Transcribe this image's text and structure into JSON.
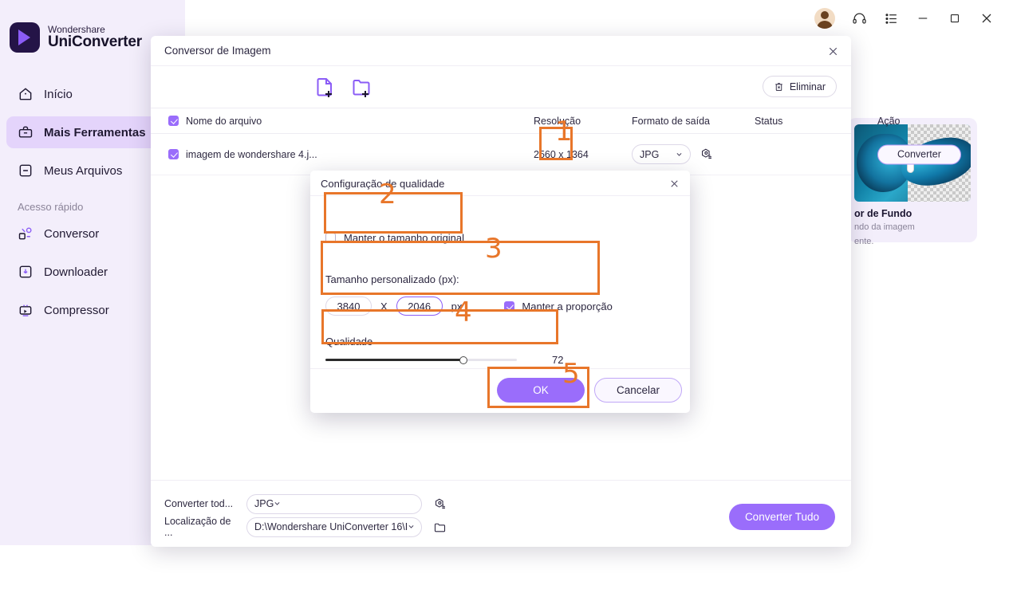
{
  "app": {
    "brand_top": "Wondershare",
    "brand_bottom": "UniConverter",
    "nav": [
      {
        "label": "Início",
        "icon": "home-icon"
      },
      {
        "label": "Mais Ferramentas",
        "icon": "toolbox-icon"
      },
      {
        "label": "Meus Arquivos",
        "icon": "files-icon"
      }
    ],
    "nav_section": "Acesso rápido",
    "quick": [
      {
        "label": "Conversor",
        "icon": "converter-icon"
      },
      {
        "label": "Downloader",
        "icon": "download-icon"
      },
      {
        "label": "Compressor",
        "icon": "compress-icon"
      }
    ],
    "window_controls": {
      "avatar": "avatar",
      "headset": "headset-icon",
      "menu": "list-menu-icon",
      "minimize": "minimize-icon",
      "maximize": "maximize-icon",
      "close": "close-icon"
    }
  },
  "tool_card": {
    "title": "or de Fundo",
    "desc_line1": "ndo da imagem",
    "desc_line2": "ente."
  },
  "modal": {
    "title": "Conversor de Imagem",
    "close_icon": "close-icon",
    "toolbar": {
      "add_file_icon": "add-file-icon",
      "add_folder_icon": "add-folder-icon",
      "delete_label": "Eliminar",
      "delete_icon": "trash-icon"
    },
    "table": {
      "headers": [
        "Nome do arquivo",
        "Resolução",
        "Formato de saída",
        "Status",
        "Ação"
      ],
      "rows": [
        {
          "checked": true,
          "name": "imagem de wondershare 4.j...",
          "resolution": "2560 x 1364",
          "format": "JPG",
          "gear_icon": "settings-image-icon",
          "status_icon": "clock-icon",
          "action": "Converter"
        }
      ]
    },
    "footer": {
      "convert_all_label": "Converter tod...",
      "convert_all_value": "JPG",
      "convert_all_gear": "settings-image-icon",
      "location_label": "Localização de ...",
      "location_value": "D:\\Wondershare UniConverter 16\\I",
      "folder_icon": "folder-icon",
      "convert_all_button": "Converter Tudo"
    }
  },
  "quality_dialog": {
    "title": "Configuração de qualidade",
    "close_icon": "close-icon",
    "keep_original_label": "Manter o tamanho original",
    "keep_original_checked": false,
    "custom_size_label": "Tamanho personalizado (px):",
    "width_value": "3840",
    "x_separator": "X",
    "height_value": "2046",
    "px_unit": "px",
    "keep_ratio_label": "Manter a proporção",
    "keep_ratio_checked": true,
    "quality_label": "Qualidade",
    "quality_value": "72",
    "ok_label": "OK",
    "cancel_label": "Cancelar"
  },
  "annotations": {
    "n1": "1",
    "n2": "2",
    "n3": "3",
    "n4": "4",
    "n5": "5",
    "color": "#e8762a"
  }
}
